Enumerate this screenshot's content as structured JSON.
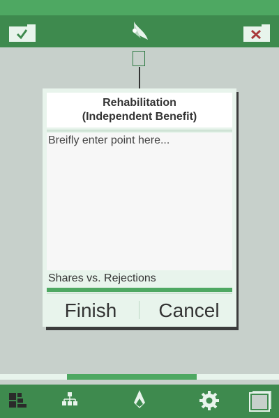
{
  "toolbar": {
    "accept_icon": "checkmark-folder-icon",
    "reject_icon": "x-folder-icon",
    "logo_icon": "bird-logo-icon"
  },
  "dialog": {
    "title": "Rehabilitation\n(Independent Benefit)",
    "placeholder": "Breifly enter point here...",
    "shares_label": "Shares vs. Rejections",
    "finish_label": "Finish",
    "cancel_label": "Cancel"
  },
  "progress": {
    "start_fraction": 0.24,
    "end_fraction": 0.705
  },
  "bottom_nav": [
    {
      "icon": "grid-map-icon"
    },
    {
      "icon": "hierarchy-icon"
    },
    {
      "icon": "bird-logo-icon"
    },
    {
      "icon": "gear-icon"
    },
    {
      "icon": "stacked-cards-icon"
    }
  ],
  "colors": {
    "accent_green": "#4ea862",
    "dark_green": "#3e8a4e",
    "background": "#c7d0cb",
    "reject_red": "#a83a3a"
  }
}
